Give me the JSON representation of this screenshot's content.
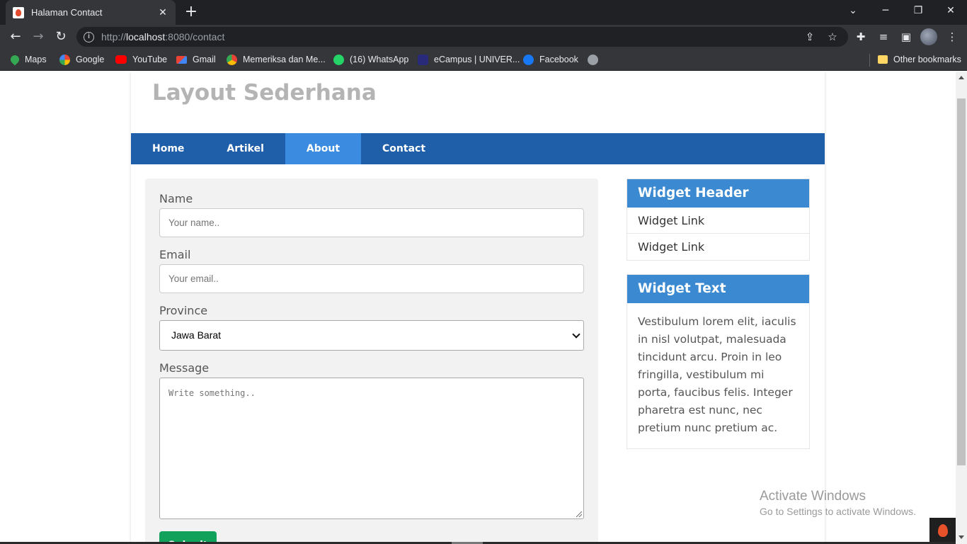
{
  "browser": {
    "tab_title": "Halaman Contact",
    "tab_close": "✕",
    "new_tab": "+",
    "url_scheme": "http://",
    "url_host": "localhost",
    "url_rest": ":8080/contact",
    "bookmarks": [
      "Maps",
      "Google",
      "YouTube",
      "Gmail",
      "Memeriksa dan Me...",
      "(16) WhatsApp",
      "eCampus | UNIVER...",
      "Facebook"
    ],
    "other_bookmarks": "Other bookmarks"
  },
  "page": {
    "site_title": "Layout Sederhana",
    "menu": [
      "Home",
      "Artikel",
      "About",
      "Contact"
    ],
    "active_menu": "About",
    "form": {
      "name_label": "Name",
      "name_placeholder": "Your name..",
      "email_label": "Email",
      "email_placeholder": "Your email..",
      "province_label": "Province",
      "province_value": "Jawa Barat",
      "message_label": "Message",
      "message_placeholder": "Write something..",
      "submit_label": "Submit"
    },
    "widget_links": {
      "header": "Widget Header",
      "links": [
        "Widget Link",
        "Widget Link"
      ]
    },
    "widget_text": {
      "header": "Widget Text",
      "body": "Vestibulum lorem elit, iaculis in nisl volutpat, malesuada tincidunt arcu. Proin in leo fringilla, vestibulum mi porta, faucibus felis. Integer pharetra est nunc, nec pretium nunc pretium ac."
    }
  },
  "os": {
    "activate_title": "Activate Windows",
    "activate_sub": "Go to Settings to activate Windows."
  },
  "colors": {
    "menu_bg": "#1f5fa9",
    "menu_active": "#3b8ce0",
    "widget_header": "#3b8ad1",
    "submit": "#12a15b"
  }
}
